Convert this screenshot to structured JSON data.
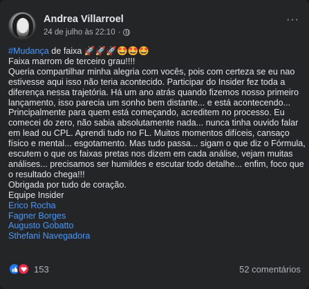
{
  "post": {
    "author": "Andrea Villarroel",
    "timestamp": "24 de julho às 22:10",
    "separator": "·",
    "more_label": "···",
    "lines": [
      {
        "parts": [
          {
            "t": "#Mudança",
            "c": "hashtag"
          },
          {
            "t": " de faixa 🚀🚀🚀🤩🤩🤩",
            "c": ""
          }
        ]
      },
      {
        "parts": [
          {
            "t": "Faixa marrom de terceiro grau!!!!",
            "c": ""
          }
        ]
      },
      {
        "parts": [
          {
            "t": "Queria compartilhar minha alegria com vocês, pois com certeza se eu nao",
            "c": ""
          }
        ]
      },
      {
        "parts": [
          {
            "t": "estivesse aqui isso não teria acontecido. Participar do Insider fez toda a",
            "c": ""
          }
        ]
      },
      {
        "parts": [
          {
            "t": "diferença nessa trajetória.  Há um ano atrás quando fizemos nosso primeiro",
            "c": ""
          }
        ]
      },
      {
        "parts": [
          {
            "t": "lançamento, isso parecia um sonho bem distante...   e está acontecendo...",
            "c": ""
          }
        ]
      },
      {
        "parts": [
          {
            "t": "Principalmente para quem está começando, acreditem no processo. Eu",
            "c": ""
          }
        ]
      },
      {
        "parts": [
          {
            "t": "comecei do zero, não sabia absolutamente nada... nunca tinha ouvido falar",
            "c": ""
          }
        ]
      },
      {
        "parts": [
          {
            "t": "em lead ou CPL.  Aprendi tudo no FL. Muitos momentos difíceis, cansaço",
            "c": ""
          }
        ]
      },
      {
        "parts": [
          {
            "t": "físico e mental... esgotamento. Mas tudo passa... sigam o que diz o Fórmula,",
            "c": ""
          }
        ]
      },
      {
        "parts": [
          {
            "t": "escutem o que os faixas pretas nos dizem em cada análise, vejam muitas",
            "c": ""
          }
        ]
      },
      {
        "parts": [
          {
            "t": "análises... precisamos ser humildes e escutar todo detalhe... enfim, foco que",
            "c": ""
          }
        ]
      },
      {
        "parts": [
          {
            "t": "o resultado chega!!!",
            "c": ""
          }
        ]
      },
      {
        "parts": [
          {
            "t": "Obrigada por tudo de coração.",
            "c": ""
          }
        ]
      },
      {
        "parts": [
          {
            "t": "Equipe Insider",
            "c": ""
          }
        ]
      },
      {
        "parts": [
          {
            "t": "Erico Rocha",
            "c": "link"
          }
        ]
      },
      {
        "parts": [
          {
            "t": "Fagner Borges",
            "c": "link"
          }
        ]
      },
      {
        "parts": [
          {
            "t": "Augusto Gobatto",
            "c": "link"
          }
        ]
      },
      {
        "parts": [
          {
            "t": "Sthefani Navegadora",
            "c": "link"
          }
        ]
      }
    ]
  },
  "footer": {
    "reaction_icons": [
      "like-icon",
      "love-icon"
    ],
    "reaction_count": "153",
    "comments": "52 comentários"
  },
  "colors": {
    "card_bg": "#242526",
    "text": "#e4e6eb",
    "secondary_text": "#b0b3b8",
    "link": "#4599ff",
    "like": "#2078f4",
    "love": "#f0284a"
  }
}
